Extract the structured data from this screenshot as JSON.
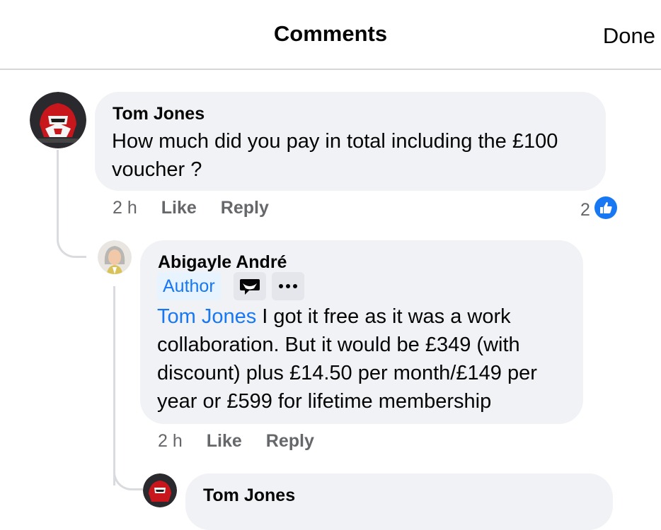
{
  "header": {
    "title": "Comments",
    "done_label": "Done"
  },
  "comments": [
    {
      "author": "Tom Jones",
      "text": "How much did you pay in total including the £100 voucher ?",
      "time": "2 h",
      "like_label": "Like",
      "reply_label": "Reply",
      "reaction_count": "2",
      "reaction_icon": "thumbs-up-icon"
    },
    {
      "author": "Abigayle André",
      "badge": "Author",
      "mention": "Tom Jones",
      "text": " I got it free as it was a work collaboration. But it would be £349 (with discount) plus £14.50 per month/£149 per year or £599 for lifetime membership",
      "time": "2 h",
      "like_label": "Like",
      "reply_label": "Reply"
    },
    {
      "author": "Tom Jones"
    }
  ],
  "colors": {
    "accent": "#1877f2",
    "bubble": "#f0f2f5",
    "muted": "#65676b"
  }
}
